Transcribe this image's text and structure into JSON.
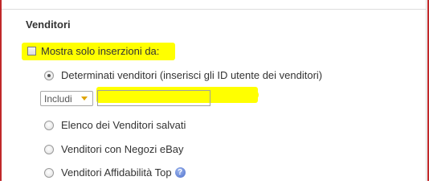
{
  "section": {
    "title": "Venditori"
  },
  "filters": {
    "mostra_label": "Mostra solo inserzioni da:",
    "options": [
      {
        "label": "Determinati venditori (inserisci gli ID utente dei venditori)",
        "selected": true
      },
      {
        "label": "Elenco dei Venditori salvati",
        "selected": false
      },
      {
        "label": "Venditori con Negozi eBay",
        "selected": false
      },
      {
        "label": "Venditori Affidabilità Top",
        "selected": false
      }
    ],
    "include_select": {
      "value": "Includi"
    },
    "seller_ids_input": {
      "value": "",
      "placeholder": ""
    },
    "help_glyph": "?"
  },
  "colors": {
    "highlight": "#ffff00",
    "frame": "#c0282a",
    "select_caret": "#e0a400",
    "help_icon": "#4d6fcc"
  }
}
